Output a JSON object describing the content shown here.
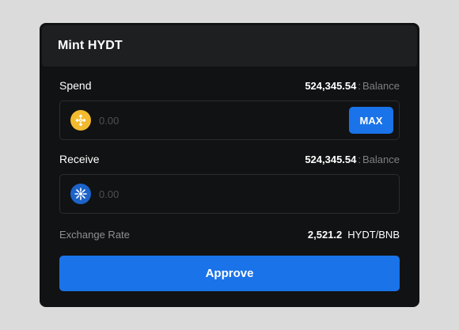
{
  "header": {
    "title": "Mint HYDT"
  },
  "spend": {
    "label": "Spend",
    "balance_value": "524,345.54",
    "balance_separator": ":",
    "balance_label": "Balance",
    "placeholder": "0.00",
    "token_icon": "bnb-token-icon",
    "max_label": "MAX"
  },
  "receive": {
    "label": "Receive",
    "balance_value": "524,345.54",
    "balance_separator": ":",
    "balance_label": "Balance",
    "placeholder": "0.00",
    "token_icon": "hydt-token-icon"
  },
  "exchange_rate": {
    "label": "Exchange Rate",
    "value": "2,521.2",
    "pair": "HYDT/BNB"
  },
  "approve": {
    "label": "Approve"
  },
  "colors": {
    "accent": "#1a73e8",
    "card_bg": "#111213",
    "header_bg": "#1d1f21",
    "bnb_yellow": "#f3ba2f",
    "hydt_blue": "#1c63c9"
  }
}
